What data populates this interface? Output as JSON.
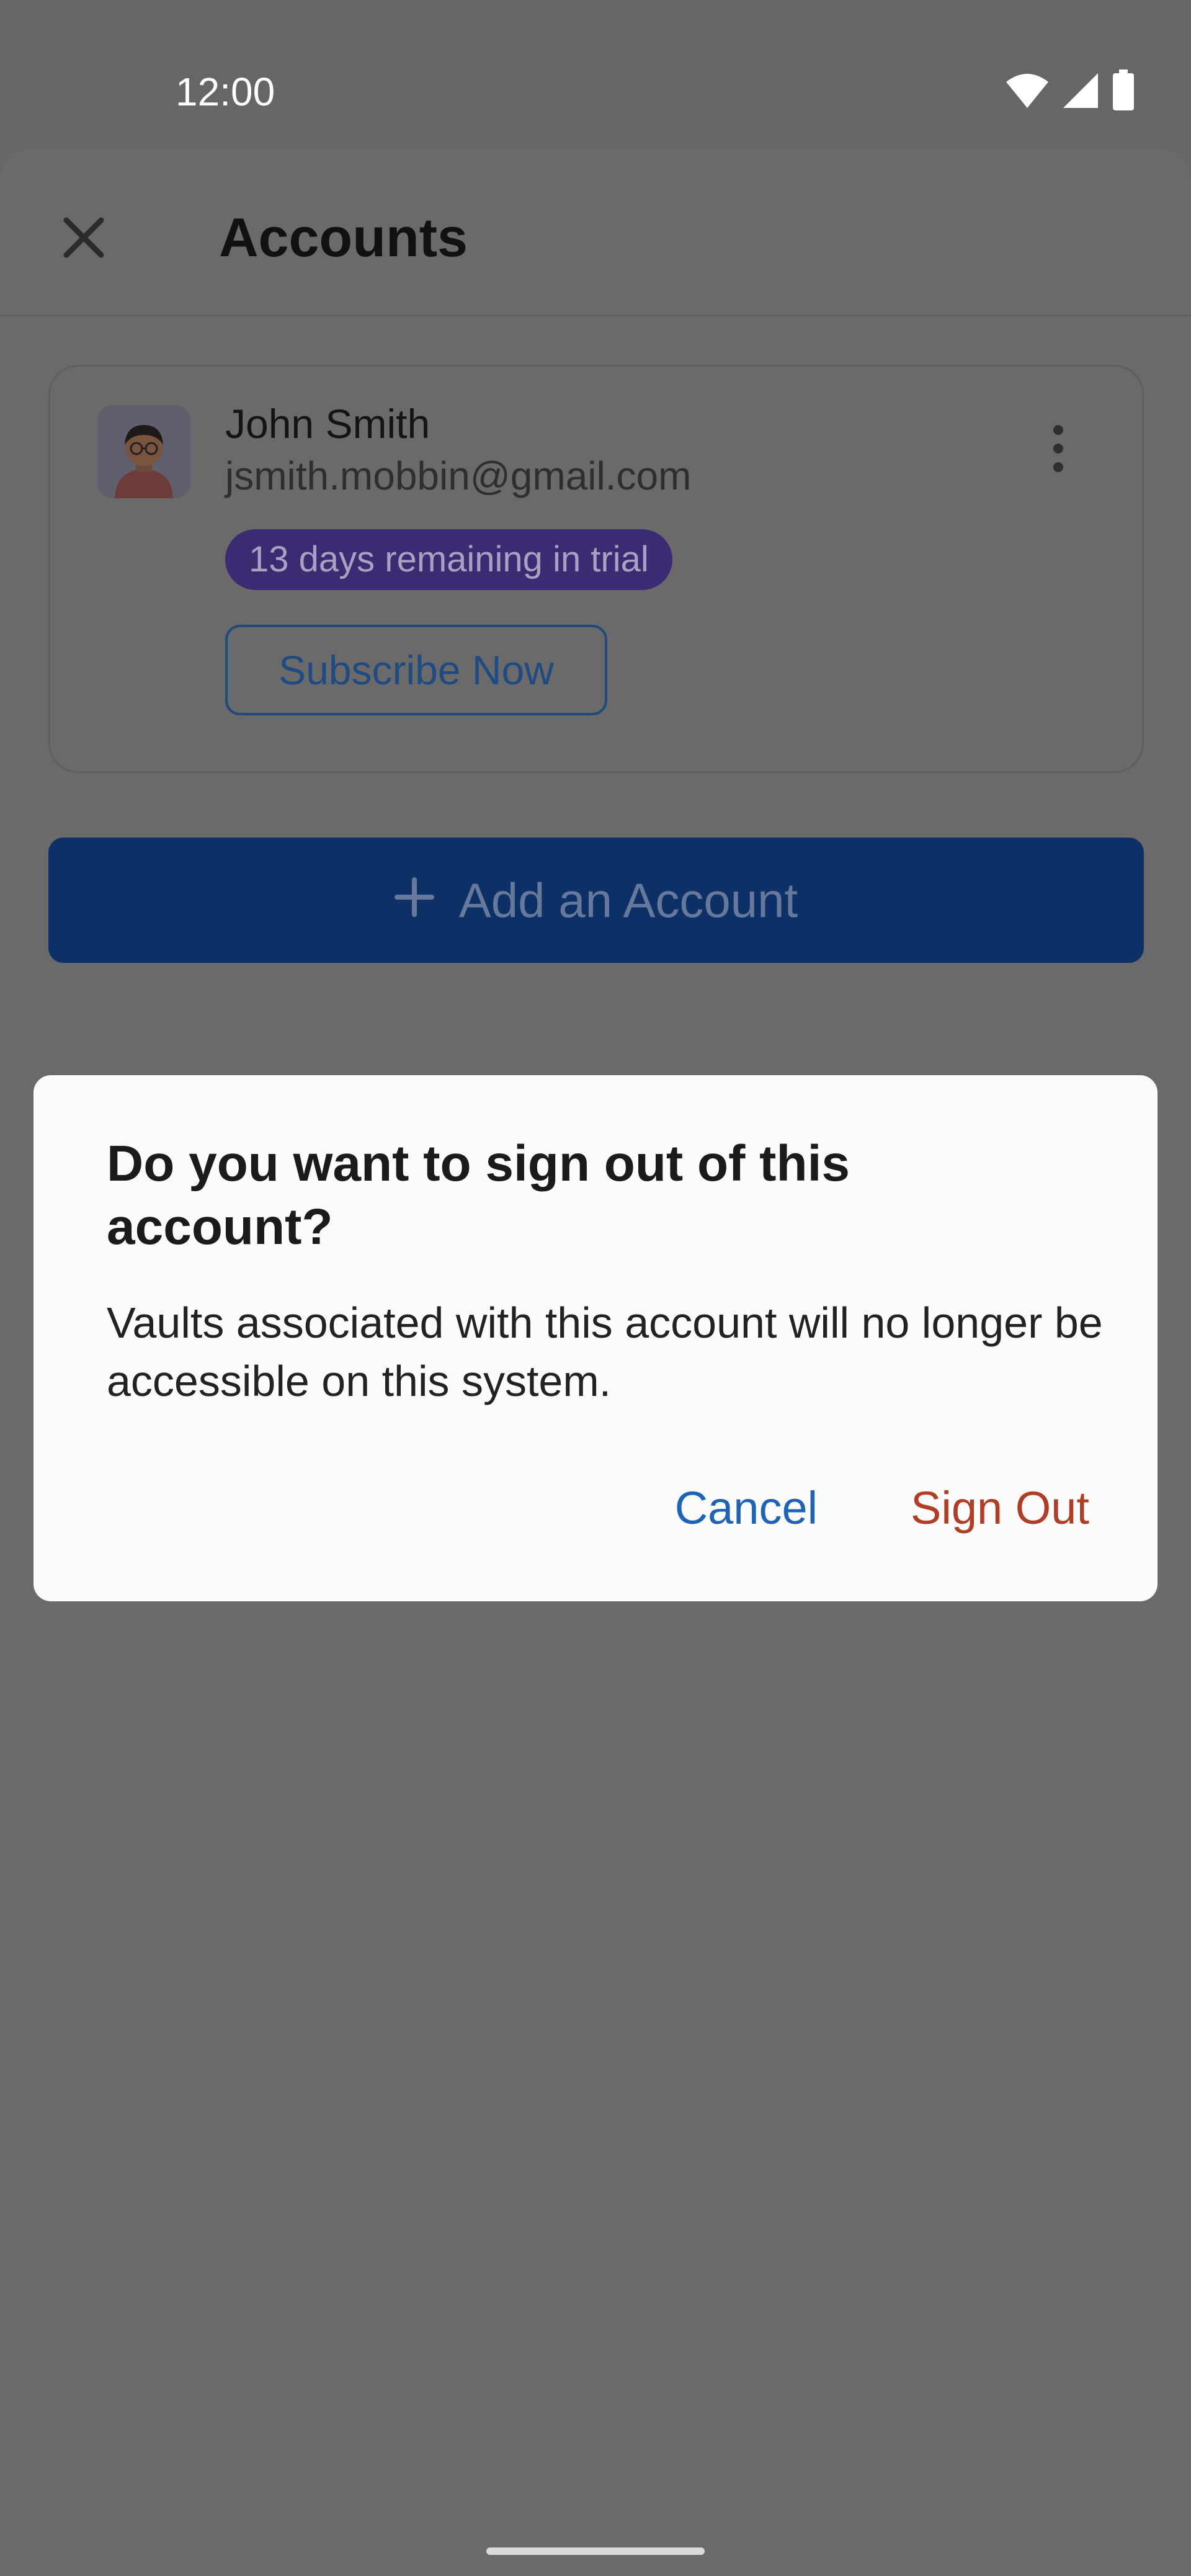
{
  "status_bar": {
    "time": "12:00"
  },
  "header": {
    "title": "Accounts"
  },
  "account": {
    "name": "John Smith",
    "email": "jsmith.mobbin@gmail.com",
    "trial_badge": "13 days remaining in trial",
    "subscribe_label": "Subscribe Now"
  },
  "add_account": {
    "label": "Add an Account"
  },
  "dialog": {
    "title": "Do you want to sign out of this account?",
    "body": "Vaults associated with this account will no longer be accessible on this system.",
    "cancel_label": "Cancel",
    "confirm_label": "Sign Out"
  },
  "icons": {
    "close": "close-icon",
    "more": "more-vertical-icon",
    "add": "plus-icon",
    "wifi": "wifi-icon",
    "signal": "signal-icon",
    "battery": "battery-icon"
  },
  "colors": {
    "scrim": "#666666",
    "primary_button": "#0d3166",
    "trial_badge": "#3c2a72",
    "cancel_text": "#1d64b8",
    "sign_out_text": "#b13e24",
    "dialog_background": "#fcfcfc"
  }
}
